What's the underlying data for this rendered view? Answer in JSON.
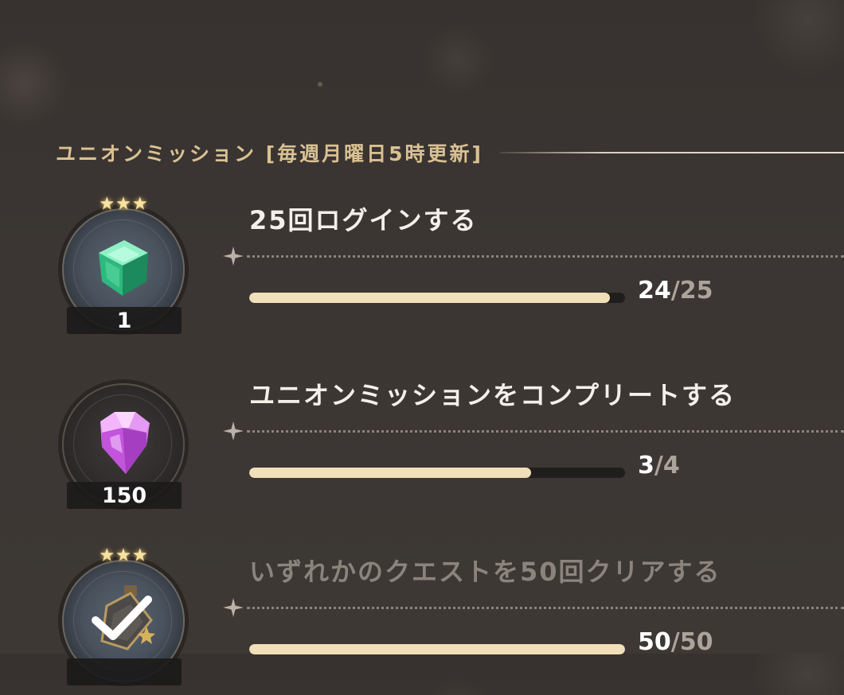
{
  "section": {
    "title": "ユニオンミッション [毎週月曜日5時更新]"
  },
  "missions": [
    {
      "title": "25回ログインする",
      "reward": {
        "icon": "green-gem-icon",
        "quantity": "1",
        "stars": [
          "★",
          "★",
          "★"
        ]
      },
      "progress": {
        "current": "24",
        "separator": "/",
        "goal": "25",
        "fraction": 0.96
      },
      "completed": false
    },
    {
      "title": "ユニオンミッションをコンプリートする",
      "reward": {
        "icon": "pink-diamond-icon",
        "quantity": "150",
        "stars": []
      },
      "progress": {
        "current": "3",
        "separator": "/",
        "goal": "4",
        "fraction": 0.75
      },
      "completed": false
    },
    {
      "title": "いずれかのクエストを50回クリアする",
      "reward": {
        "icon": "potion-bottle-icon",
        "quantity": "",
        "stars": [
          "★",
          "★",
          "★"
        ]
      },
      "progress": {
        "current": "50",
        "separator": "/",
        "goal": "50",
        "fraction": 1.0
      },
      "completed": true
    }
  ],
  "colors": {
    "background": "#3a3532",
    "section_title": "#d9c192",
    "progress_fill": "#f1dfb9",
    "progress_track": "#201e1d"
  }
}
